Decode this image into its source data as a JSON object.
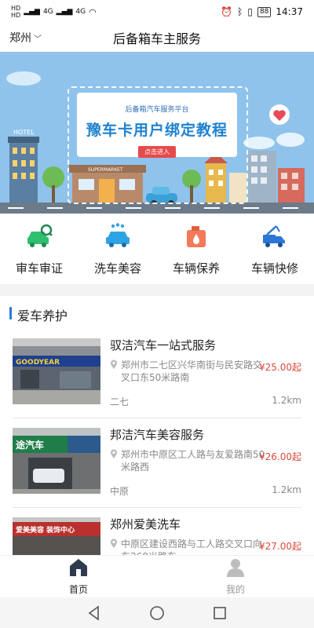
{
  "status_bar": {
    "left_sim1": "HD",
    "left_sim2": "HD",
    "left_network1": "4G",
    "left_network2": "4G",
    "battery": "88",
    "time": "14:37"
  },
  "header": {
    "city": "郑州",
    "title": "后备箱车主服务"
  },
  "banner": {
    "subtitle": "后备箱汽车服务平台",
    "headline": "豫车卡用户绑定教程",
    "button": "点击进入",
    "hotel_sign": "HOTEL",
    "market_sign": "SUPERMARKET"
  },
  "quick_menu": [
    {
      "label": "审车审证",
      "icon": "car-inspection-icon"
    },
    {
      "label": "洗车美容",
      "icon": "car-wash-icon"
    },
    {
      "label": "车辆保养",
      "icon": "oil-maintenance-icon"
    },
    {
      "label": "车辆快修",
      "icon": "tow-truck-icon"
    }
  ],
  "section": {
    "title": "爱车养护"
  },
  "shops": [
    {
      "name": "驭洁汽车一站式服务",
      "address": "郑州市二七区兴华南街与民安路交叉口东50米路南",
      "price": "¥25.00起",
      "district": "二七",
      "distance": "1.2km",
      "thumb_sign": "GOODYEAR"
    },
    {
      "name": "邦洁汽车美容服务",
      "address": "郑州市中原区工人路与友爱路南50米路西",
      "price": "¥26.00起",
      "district": "中原",
      "distance": "1.2km",
      "thumb_sign": "途汽车"
    },
    {
      "name": "郑州爱美洗车",
      "address": "中原区建设西路与工人路交叉口向东260米路东",
      "price": "¥27.00起",
      "district": "",
      "distance": "",
      "thumb_sign": "爱美美容 装饰中心"
    }
  ],
  "tabbar": {
    "home": "首页",
    "mine": "我的"
  },
  "colors": {
    "accent_blue": "#2b78d6",
    "price_red": "#d94a3b",
    "banner_sky": "#8fc3ec"
  }
}
